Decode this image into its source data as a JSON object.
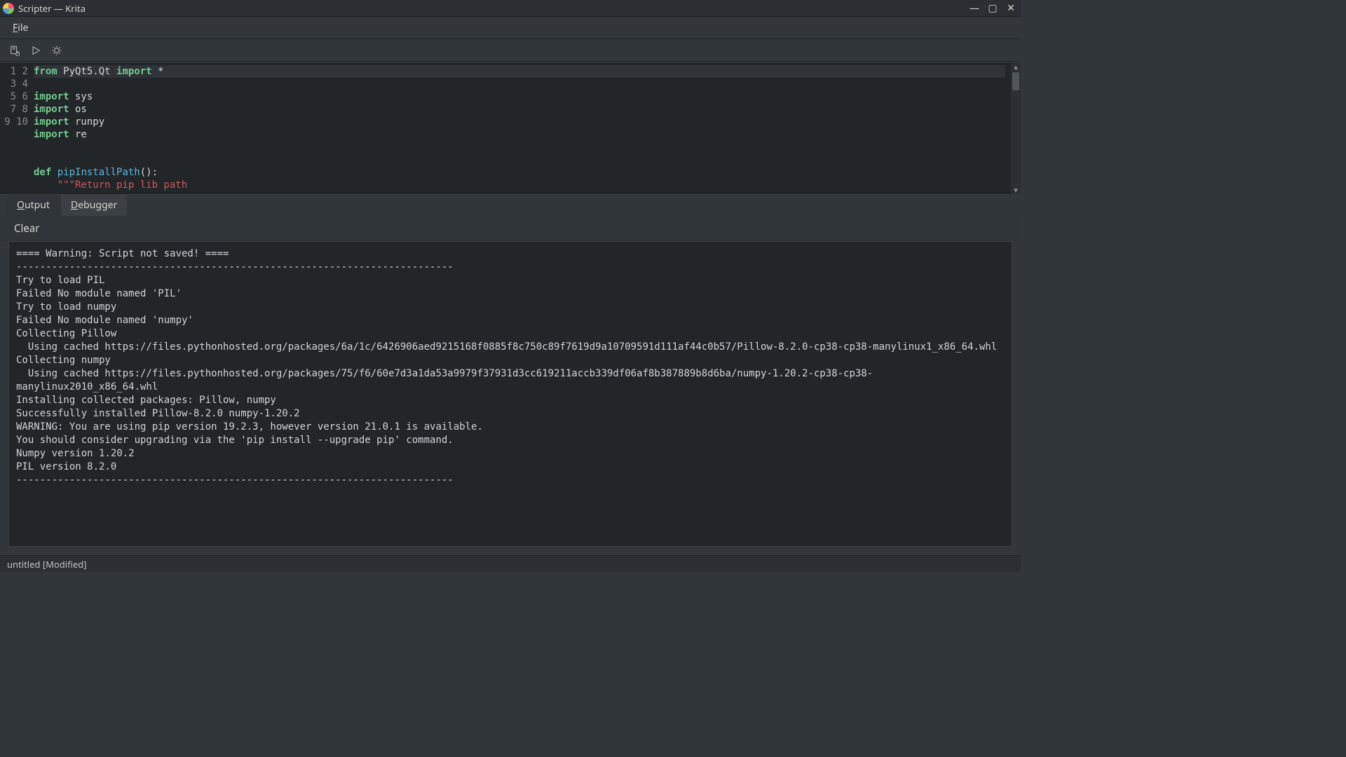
{
  "window": {
    "title": "Scripter — Krita"
  },
  "menubar": {
    "file": "File"
  },
  "toolbar": {
    "icons": [
      "document-reload-icon",
      "run-icon",
      "debug-icon"
    ]
  },
  "editor": {
    "line_numbers": [
      "1",
      "2",
      "3",
      "4",
      "5",
      "6",
      "7",
      "8",
      "9",
      "10"
    ],
    "lines": [
      {
        "t": "kw",
        "a": "from",
        "b": " PyQt5.Qt ",
        "c": "import",
        "d": " *"
      },
      {
        "t": "blank"
      },
      {
        "t": "imp",
        "a": "import",
        "b": " sys"
      },
      {
        "t": "imp",
        "a": "import",
        "b": " os"
      },
      {
        "t": "imp",
        "a": "import",
        "b": " runpy"
      },
      {
        "t": "imp",
        "a": "import",
        "b": " re"
      },
      {
        "t": "blank"
      },
      {
        "t": "blank"
      },
      {
        "t": "def",
        "a": "def",
        "b": " ",
        "c": "pipInstallPath",
        "d": "():"
      },
      {
        "t": "doc",
        "indent": "    ",
        "a": "\"\"\"Return pip lib path"
      }
    ]
  },
  "panel": {
    "tabs": {
      "output": "Output",
      "debugger": "Debugger"
    },
    "clear_label": "Clear"
  },
  "output_text": "==== Warning: Script not saved! ====\n--------------------------------------------------------------------------\nTry to load PIL\nFailed No module named 'PIL'\nTry to load numpy\nFailed No module named 'numpy'\nCollecting Pillow\n  Using cached https://files.pythonhosted.org/packages/6a/1c/6426906aed9215168f0885f8c750c89f7619d9a10709591d111af44c0b57/Pillow-8.2.0-cp38-cp38-manylinux1_x86_64.whl\nCollecting numpy\n  Using cached https://files.pythonhosted.org/packages/75/f6/60e7d3a1da53a9979f37931d3cc619211accb339df06af8b387889b8d6ba/numpy-1.20.2-cp38-cp38-manylinux2010_x86_64.whl\nInstalling collected packages: Pillow, numpy\nSuccessfully installed Pillow-8.2.0 numpy-1.20.2\nWARNING: You are using pip version 19.2.3, however version 21.0.1 is available.\nYou should consider upgrading via the 'pip install --upgrade pip' command.\nNumpy version 1.20.2\nPIL version 8.2.0\n--------------------------------------------------------------------------",
  "status": {
    "text": "untitled [Modified]"
  }
}
